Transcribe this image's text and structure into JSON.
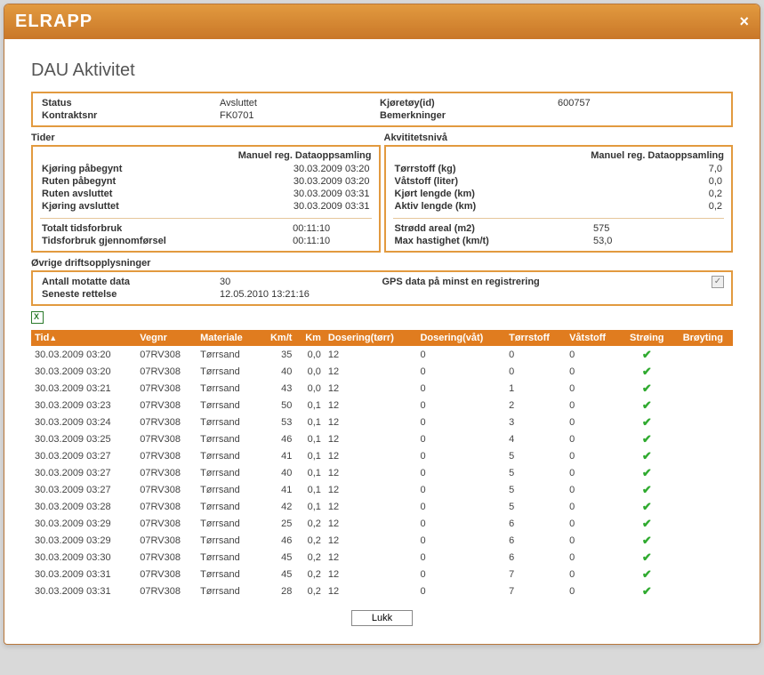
{
  "window": {
    "title": "ELRAPP",
    "close": "×"
  },
  "page_title": "DAU Aktivitet",
  "header": {
    "status_label": "Status",
    "status_value": "Avsluttet",
    "vehicle_label": "Kjøretøy(id)",
    "vehicle_value": "600757",
    "contract_label": "Kontraktsnr",
    "contract_value": "FK0701",
    "remarks_label": "Bemerkninger",
    "remarks_value": ""
  },
  "tider": {
    "section": "Tider",
    "subheader": "Manuel reg. Dataoppsamling",
    "rows": [
      {
        "label": "Kjøring påbegynt",
        "value": "30.03.2009 03:20"
      },
      {
        "label": "Ruten påbegynt",
        "value": "30.03.2009 03:20"
      },
      {
        "label": "Ruten avsluttet",
        "value": "30.03.2009 03:31"
      },
      {
        "label": "Kjøring avsluttet",
        "value": "30.03.2009 03:31"
      }
    ],
    "rows2": [
      {
        "label": "Totalt tidsforbruk",
        "value": "00:11:10"
      },
      {
        "label": "Tidsforbruk gjennomførsel",
        "value": "00:11:10"
      }
    ]
  },
  "akvit": {
    "section": "Akvititetsnivå",
    "subheader": "Manuel reg. Dataoppsamling",
    "rows": [
      {
        "label": "Tørrstoff (kg)",
        "value": "7,0"
      },
      {
        "label": "Våtstoff (liter)",
        "value": "0,0"
      },
      {
        "label": "Kjørt lengde (km)",
        "value": "0,2"
      },
      {
        "label": "Aktiv lengde (km)",
        "value": "0,2"
      }
    ],
    "rows2": [
      {
        "label": "Strødd areal (m2)",
        "value": "575"
      },
      {
        "label": "Max hastighet (km/t)",
        "value": "53,0"
      }
    ]
  },
  "ovrige": {
    "section": "Øvrige driftsopplysninger",
    "antall_label": "Antall motatte data",
    "antall_value": "30",
    "gps_label": "GPS data på minst en registrering",
    "gps_checked": true,
    "seneste_label": "Seneste rettelse",
    "seneste_value": "12.05.2010 13:21:16"
  },
  "table": {
    "headers": {
      "tid": "Tid",
      "vegnr": "Vegnr",
      "materiale": "Materiale",
      "kmt": "Km/t",
      "km": "Km",
      "dos_torr": "Dosering(tørr)",
      "dos_vat": "Dosering(våt)",
      "torrstoff": "Tørrstoff",
      "vatstoff": "Våtstoff",
      "stroing": "Strøing",
      "broyting": "Brøyting"
    },
    "rows": [
      {
        "tid": "30.03.2009 03:20",
        "vegnr": "07RV308",
        "mat": "Tørrsand",
        "kmt": "35",
        "km": "0,0",
        "dt": "12",
        "dv": "0",
        "ts": "0",
        "vs": "0",
        "str": true,
        "br": false
      },
      {
        "tid": "30.03.2009 03:20",
        "vegnr": "07RV308",
        "mat": "Tørrsand",
        "kmt": "40",
        "km": "0,0",
        "dt": "12",
        "dv": "0",
        "ts": "0",
        "vs": "0",
        "str": true,
        "br": false
      },
      {
        "tid": "30.03.2009 03:21",
        "vegnr": "07RV308",
        "mat": "Tørrsand",
        "kmt": "43",
        "km": "0,0",
        "dt": "12",
        "dv": "0",
        "ts": "1",
        "vs": "0",
        "str": true,
        "br": false
      },
      {
        "tid": "30.03.2009 03:23",
        "vegnr": "07RV308",
        "mat": "Tørrsand",
        "kmt": "50",
        "km": "0,1",
        "dt": "12",
        "dv": "0",
        "ts": "2",
        "vs": "0",
        "str": true,
        "br": false
      },
      {
        "tid": "30.03.2009 03:24",
        "vegnr": "07RV308",
        "mat": "Tørrsand",
        "kmt": "53",
        "km": "0,1",
        "dt": "12",
        "dv": "0",
        "ts": "3",
        "vs": "0",
        "str": true,
        "br": false
      },
      {
        "tid": "30.03.2009 03:25",
        "vegnr": "07RV308",
        "mat": "Tørrsand",
        "kmt": "46",
        "km": "0,1",
        "dt": "12",
        "dv": "0",
        "ts": "4",
        "vs": "0",
        "str": true,
        "br": false
      },
      {
        "tid": "30.03.2009 03:27",
        "vegnr": "07RV308",
        "mat": "Tørrsand",
        "kmt": "41",
        "km": "0,1",
        "dt": "12",
        "dv": "0",
        "ts": "5",
        "vs": "0",
        "str": true,
        "br": false
      },
      {
        "tid": "30.03.2009 03:27",
        "vegnr": "07RV308",
        "mat": "Tørrsand",
        "kmt": "40",
        "km": "0,1",
        "dt": "12",
        "dv": "0",
        "ts": "5",
        "vs": "0",
        "str": true,
        "br": false
      },
      {
        "tid": "30.03.2009 03:27",
        "vegnr": "07RV308",
        "mat": "Tørrsand",
        "kmt": "41",
        "km": "0,1",
        "dt": "12",
        "dv": "0",
        "ts": "5",
        "vs": "0",
        "str": true,
        "br": false
      },
      {
        "tid": "30.03.2009 03:28",
        "vegnr": "07RV308",
        "mat": "Tørrsand",
        "kmt": "42",
        "km": "0,1",
        "dt": "12",
        "dv": "0",
        "ts": "5",
        "vs": "0",
        "str": true,
        "br": false
      },
      {
        "tid": "30.03.2009 03:29",
        "vegnr": "07RV308",
        "mat": "Tørrsand",
        "kmt": "25",
        "km": "0,2",
        "dt": "12",
        "dv": "0",
        "ts": "6",
        "vs": "0",
        "str": true,
        "br": false
      },
      {
        "tid": "30.03.2009 03:29",
        "vegnr": "07RV308",
        "mat": "Tørrsand",
        "kmt": "46",
        "km": "0,2",
        "dt": "12",
        "dv": "0",
        "ts": "6",
        "vs": "0",
        "str": true,
        "br": false
      },
      {
        "tid": "30.03.2009 03:30",
        "vegnr": "07RV308",
        "mat": "Tørrsand",
        "kmt": "45",
        "km": "0,2",
        "dt": "12",
        "dv": "0",
        "ts": "6",
        "vs": "0",
        "str": true,
        "br": false
      },
      {
        "tid": "30.03.2009 03:31",
        "vegnr": "07RV308",
        "mat": "Tørrsand",
        "kmt": "45",
        "km": "0,2",
        "dt": "12",
        "dv": "0",
        "ts": "7",
        "vs": "0",
        "str": true,
        "br": false
      },
      {
        "tid": "30.03.2009 03:31",
        "vegnr": "07RV308",
        "mat": "Tørrsand",
        "kmt": "28",
        "km": "0,2",
        "dt": "12",
        "dv": "0",
        "ts": "7",
        "vs": "0",
        "str": true,
        "br": false
      }
    ]
  },
  "buttons": {
    "close": "Lukk"
  }
}
